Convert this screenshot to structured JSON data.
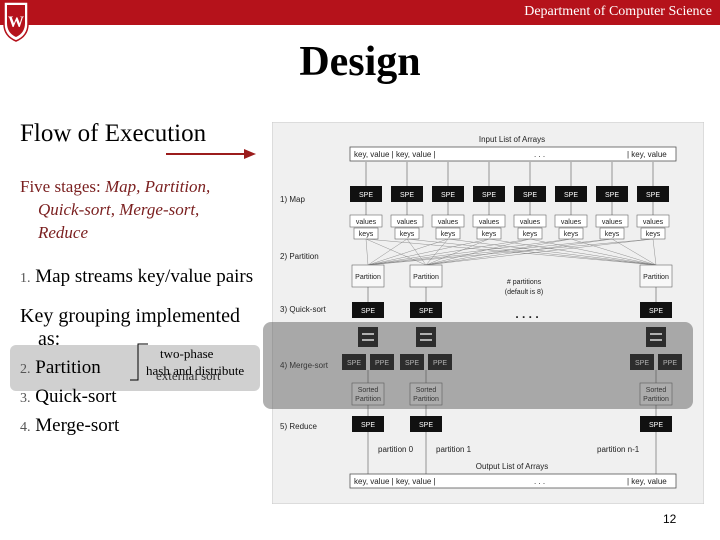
{
  "header": {
    "department": "Department of Computer Science"
  },
  "slide": {
    "title": "Design",
    "subtitle": "Flow of Execution",
    "stages_intro": "Five stages:",
    "stages_list_line1": "Map, Partition,",
    "stages_list_line2": "Quick-sort, Merge-sort,",
    "stages_list_line3": "Reduce",
    "step1_num": "1.",
    "step1_text": "Map streams key/value pairs",
    "key_grouping_line1": "Key grouping implemented",
    "key_grouping_line2": "as:",
    "step2_num": "2.",
    "step2_text": "Partition",
    "step3_num": "3.",
    "step3_text": "Quick-sort",
    "step4_num": "4.",
    "step4_text": "Merge-sort",
    "annotation_top": "two-phase",
    "annotation_a": "hash and distribute",
    "annotation_b": "external sort",
    "page_number": "12"
  },
  "diagram": {
    "input_title": "Input List of Arrays",
    "input_left": "key, value | key, value |",
    "input_dots": ". . .",
    "input_right": "| key, value",
    "stage_labels": [
      "1) Map",
      "2) Partition",
      "3) Quick-sort",
      "4) Merge-sort",
      "5) Reduce"
    ],
    "spe_label": "SPE",
    "ppe_label": "PPE",
    "values_label": "values",
    "keys_label": "keys",
    "partition_label": "Partition",
    "sorted_partition_label": "Sorted Partition",
    "num_partitions_line1": "# partitions",
    "num_partitions_line2": "(default is 8)",
    "dots": ". . . .",
    "partition_0": "partition 0",
    "partition_1": "partition 1",
    "partition_n": "partition n-1",
    "output_title": "Output List of Arrays",
    "output_left": "key, value | key, value |",
    "output_dots": ". . .",
    "output_right": "| key, value"
  },
  "colors": {
    "header_red": "#b5121b",
    "accent_red": "#7a1f1f",
    "spe_black": "#111111"
  }
}
